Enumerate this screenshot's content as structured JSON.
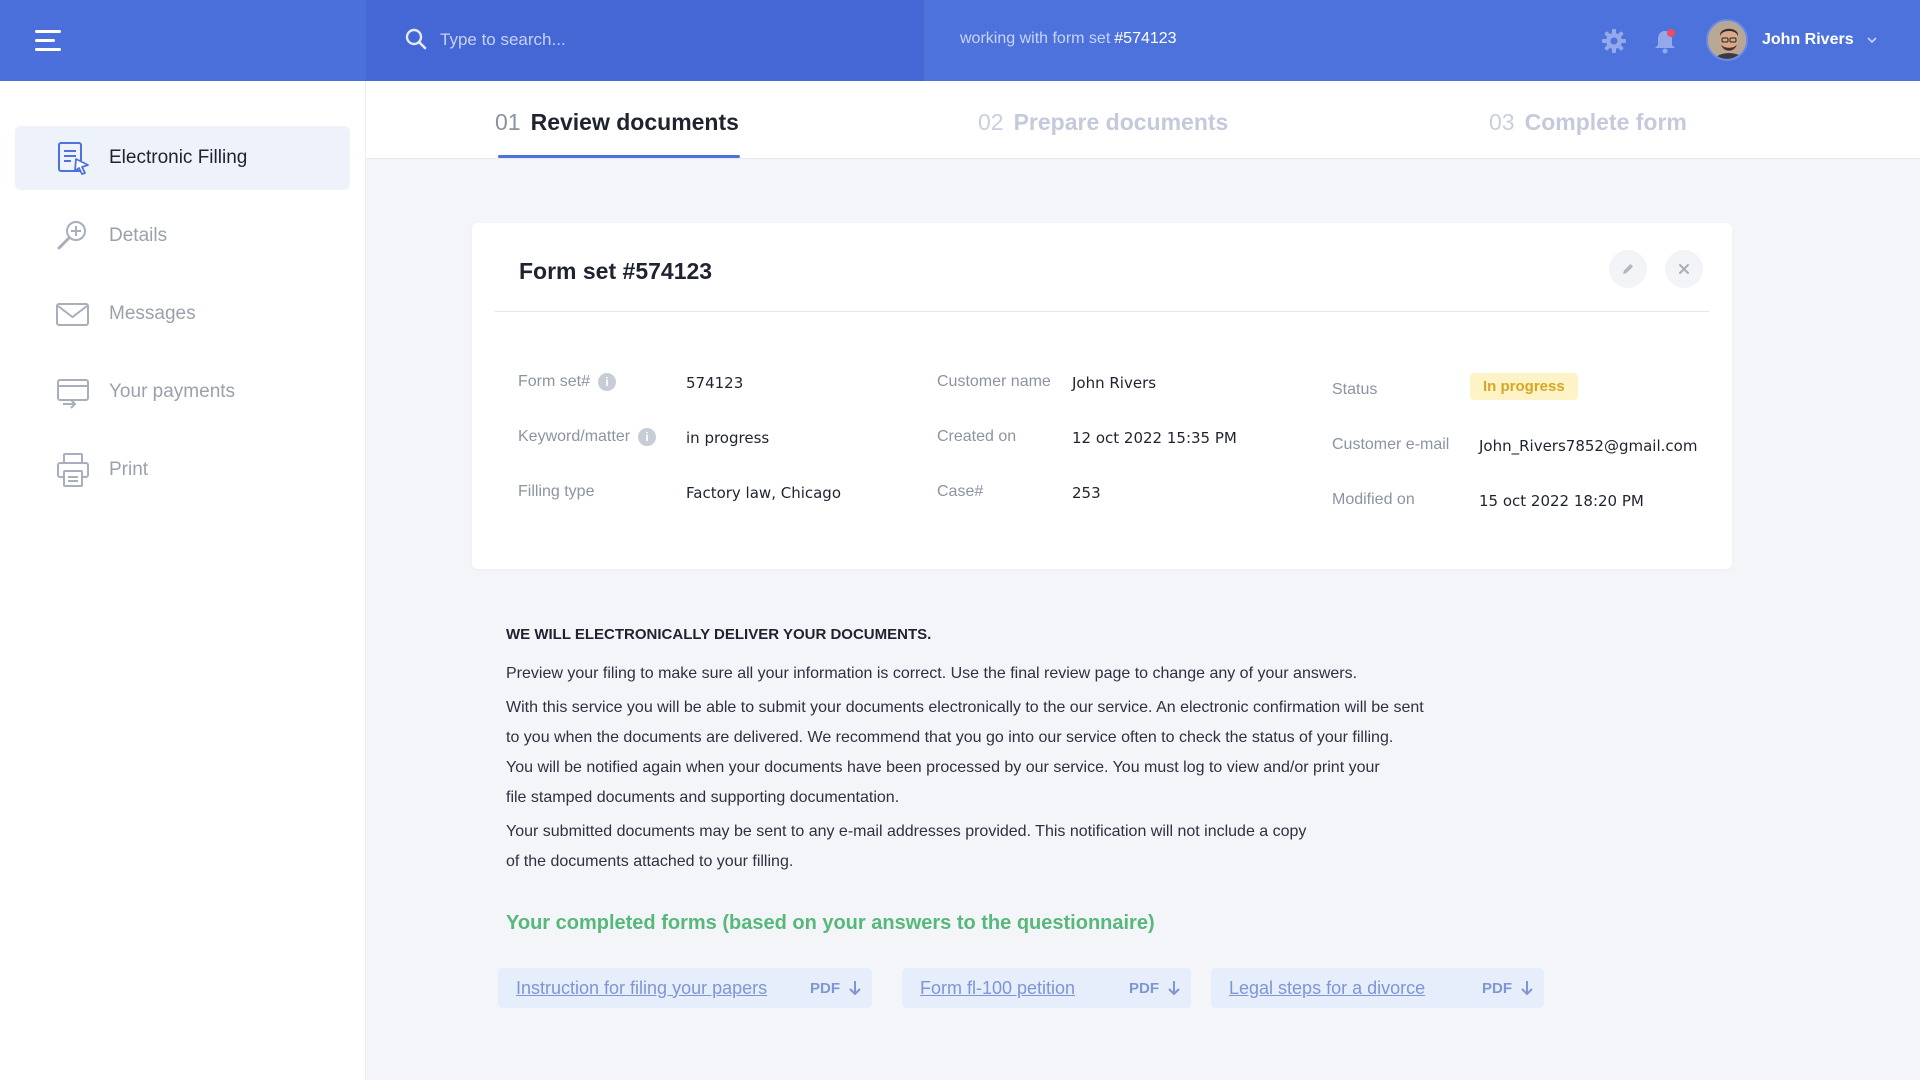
{
  "header": {
    "search_placeholder": "Type to search...",
    "working_prefix": "working with form set",
    "working_form_number": "#574123",
    "user_name": "John Rivers"
  },
  "sidebar": {
    "items": [
      {
        "label": "Electronic Filling",
        "icon": "document-cursor-icon",
        "active": true
      },
      {
        "label": "Details",
        "icon": "magnify-plus-icon",
        "active": false
      },
      {
        "label": "Messages",
        "icon": "envelope-icon",
        "active": false
      },
      {
        "label": "Your payments",
        "icon": "payment-icon",
        "active": false
      },
      {
        "label": "Print",
        "icon": "printer-icon",
        "active": false
      }
    ]
  },
  "steps": [
    {
      "num": "01",
      "label": "Review documents",
      "active": true
    },
    {
      "num": "02",
      "label": "Prepare documents",
      "active": false
    },
    {
      "num": "03",
      "label": "Complete form",
      "active": false
    }
  ],
  "card": {
    "title": "Form set #574123",
    "fields": {
      "form_set_label": "Form set#",
      "form_set_value": "574123",
      "keyword_label": "Keyword/matter",
      "keyword_value": "in progress",
      "filling_type_label": "Filling type",
      "filling_type_value": "Factory law, Chicago",
      "customer_name_label": "Customer name",
      "customer_name_value": "John Rivers",
      "created_on_label": "Created on",
      "created_on_value": "12 oct 2022  15:35 PM",
      "case_label": "Case#",
      "case_value": "253",
      "status_label": "Status",
      "status_value": "In progress",
      "email_label": "Customer e-mail",
      "email_value": "John_Rivers7852@gmail.com",
      "modified_label": "Modified on",
      "modified_value": "15 oct 2022  18:20 PM"
    }
  },
  "notice": {
    "heading": "WE WILL ELECTRONICALLY DELIVER YOUR DOCUMENTS.",
    "p1": "Preview your filing to make sure all your information is correct. Use the final review page to change any of your answers.",
    "p2_l1": "With this service you will be able to submit your documents electronically to the our service. An electronic confirmation will be sent",
    "p2_l2": "to you when the documents are delivered. We recommend that you go into our service often to check the status of your filling.",
    "p2_l3": "You will be notified again when your documents have been processed by our service. You must log  to view and/or print your",
    "p2_l4": "file stamped documents and supporting documentation.",
    "p3_l1": "Your submitted documents may be sent to any e-mail addresses provided. This notification will not include a copy",
    "p3_l2": "of the documents attached to your filling."
  },
  "forms": {
    "title": "Your completed forms (based on your answers to the questionnaire)",
    "links": [
      {
        "label": "Instruction for filing your papers",
        "type": "PDF"
      },
      {
        "label": "Form fl-100 petition",
        "type": "PDF"
      },
      {
        "label": "Legal steps for a divorce",
        "type": "PDF"
      }
    ]
  },
  "colors": {
    "brand": "#4d72dc",
    "status_bg": "#fdf3c6",
    "status_text": "#d6a722",
    "forms_title": "#56b87a"
  }
}
